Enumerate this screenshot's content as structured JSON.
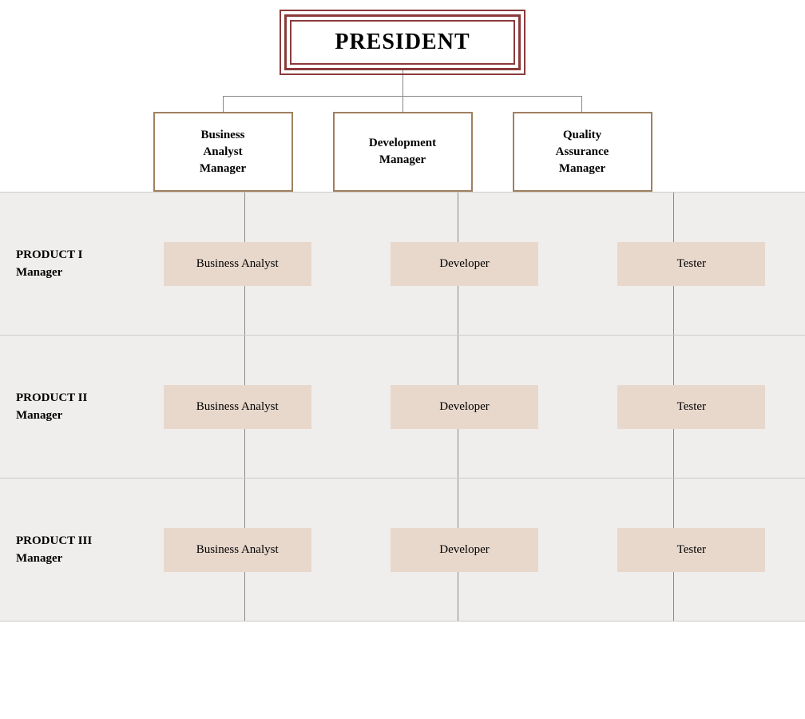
{
  "president": {
    "label": "PRESIDENT"
  },
  "managers": [
    {
      "id": "bam",
      "label": "Business\nAnalyst\nManager"
    },
    {
      "id": "dm",
      "label": "Development\nManager"
    },
    {
      "id": "qam",
      "label": "Quality\nAssurance\nManager"
    }
  ],
  "products": [
    {
      "id": "p1",
      "label": "PRODUCT I\nManager",
      "roles": [
        "Business Analyst",
        "Developer",
        "Tester"
      ]
    },
    {
      "id": "p2",
      "label": "PRODUCT II\nManager",
      "roles": [
        "Business Analyst",
        "Developer",
        "Tester"
      ]
    },
    {
      "id": "p3",
      "label": "PRODUCT III\nManager",
      "roles": [
        "Business Analyst",
        "Developer",
        "Tester"
      ]
    }
  ]
}
